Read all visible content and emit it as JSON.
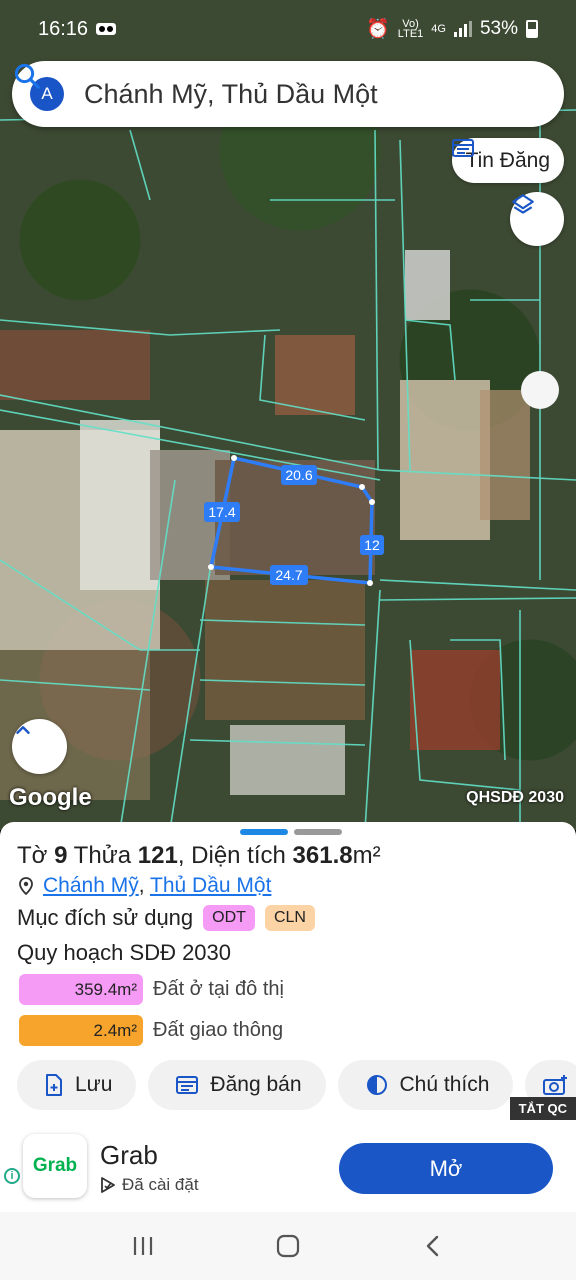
{
  "status": {
    "time": "16:16",
    "battery": "53%",
    "network": "4G"
  },
  "search": {
    "avatar_letter": "A",
    "query": "Chánh Mỹ, Thủ Dầu Một"
  },
  "map": {
    "tin_dang_label": "Tin Đăng",
    "google_label": "Google",
    "map_tag": "QHSDĐ 2030",
    "edges": {
      "top": "20.6",
      "left": "17.4",
      "right": "12",
      "bottom": "24.7"
    }
  },
  "parcel": {
    "to_label": "Tờ",
    "to_value": "9",
    "thua_label": "Thửa",
    "thua_value": "121",
    "dien_tich_label": "Diện tích",
    "area_value": "361.8",
    "area_unit": "m²",
    "location_ward": "Chánh Mỹ",
    "location_city": "Thủ Dầu Một",
    "purpose_label": "Mục đích sử dụng",
    "purpose_codes": [
      "ODT",
      "CLN"
    ],
    "plan_title": "Quy hoạch SDĐ 2030",
    "plan_items": [
      {
        "value": "359.4m²",
        "label": "Đất ở tại đô thị",
        "color": "#f59af5"
      },
      {
        "value": "2.4m²",
        "label": "Đất giao thông",
        "color": "#f7a42c"
      }
    ]
  },
  "actions": {
    "save": "Lưu",
    "post": "Đăng bán",
    "legend": "Chú thích"
  },
  "ad": {
    "badge": "TẮT QC",
    "logo_text": "Grab",
    "name": "Grab",
    "subtitle": "Đã cài đặt",
    "open_label": "Mở"
  },
  "colors": {
    "accent": "#1a56c6",
    "parcel_outline": "#2f7df6",
    "lot_lines": "#62e0c8"
  }
}
